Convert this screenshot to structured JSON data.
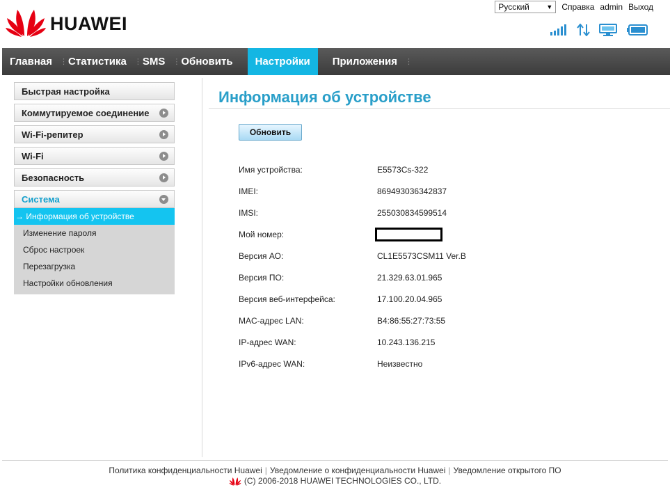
{
  "brand": {
    "name": "HUAWEI"
  },
  "top": {
    "language": "Русский",
    "help": "Справка",
    "user": "admin",
    "logout": "Выход"
  },
  "nav": {
    "items": [
      {
        "label": "Главная",
        "active": false
      },
      {
        "label": "Статистика",
        "active": false
      },
      {
        "label": "SMS",
        "active": false
      },
      {
        "label": "Обновить",
        "active": false
      },
      {
        "label": "Настройки",
        "active": true
      },
      {
        "label": "Приложения",
        "active": false
      }
    ]
  },
  "sidebar": {
    "items": [
      {
        "label": "Быстрая настройка"
      },
      {
        "label": "Коммутируемое соединение"
      },
      {
        "label": "Wi-Fi-репитер"
      },
      {
        "label": "Wi-Fi"
      },
      {
        "label": "Безопасность"
      },
      {
        "label": "Система"
      }
    ],
    "submenu": [
      {
        "label": "→ Информация об устройстве",
        "active": true
      },
      {
        "label": "Изменение пароля"
      },
      {
        "label": "Сброс настроек"
      },
      {
        "label": "Перезагрузка"
      },
      {
        "label": "Настройки обновления"
      }
    ]
  },
  "main": {
    "title": "Информация об устройстве",
    "refresh_label": "Обновить",
    "rows": [
      {
        "label": "Имя устройства:",
        "value": "E5573Cs-322"
      },
      {
        "label": "IMEI:",
        "value": "869493036342837"
      },
      {
        "label": "IMSI:",
        "value": "255030834599514"
      },
      {
        "label": "Мой номер:",
        "value": ""
      },
      {
        "label": "Версия АО:",
        "value": "CL1E5573CSM11 Ver.B"
      },
      {
        "label": "Версия ПО:",
        "value": "21.329.63.01.965"
      },
      {
        "label": "Версия веб-интерфейса:",
        "value": "17.100.20.04.965"
      },
      {
        "label": "MAC-адрес LAN:",
        "value": "B4:86:55:27:73:55"
      },
      {
        "label": "IP-адрес WAN:",
        "value": "10.243.136.215"
      },
      {
        "label": "IPv6-адрес WAN:",
        "value": "Неизвестно"
      }
    ]
  },
  "footer": {
    "privacy_policy": "Политика конфиденциальности Huawei",
    "privacy_notice": "Уведомление о конфиденциальности Huawei",
    "open_source": "Уведомление открытого ПО",
    "copyright": "(C) 2006-2018 HUAWEI TECHNOLOGIES CO., LTD."
  },
  "colors": {
    "accent": "#14b6e3",
    "title": "#2a9fc9",
    "brand_red": "#e60012",
    "nav_bg": "#444444"
  },
  "icons": [
    "signal-icon",
    "data-transfer-icon",
    "computer-icon",
    "battery-icon"
  ]
}
